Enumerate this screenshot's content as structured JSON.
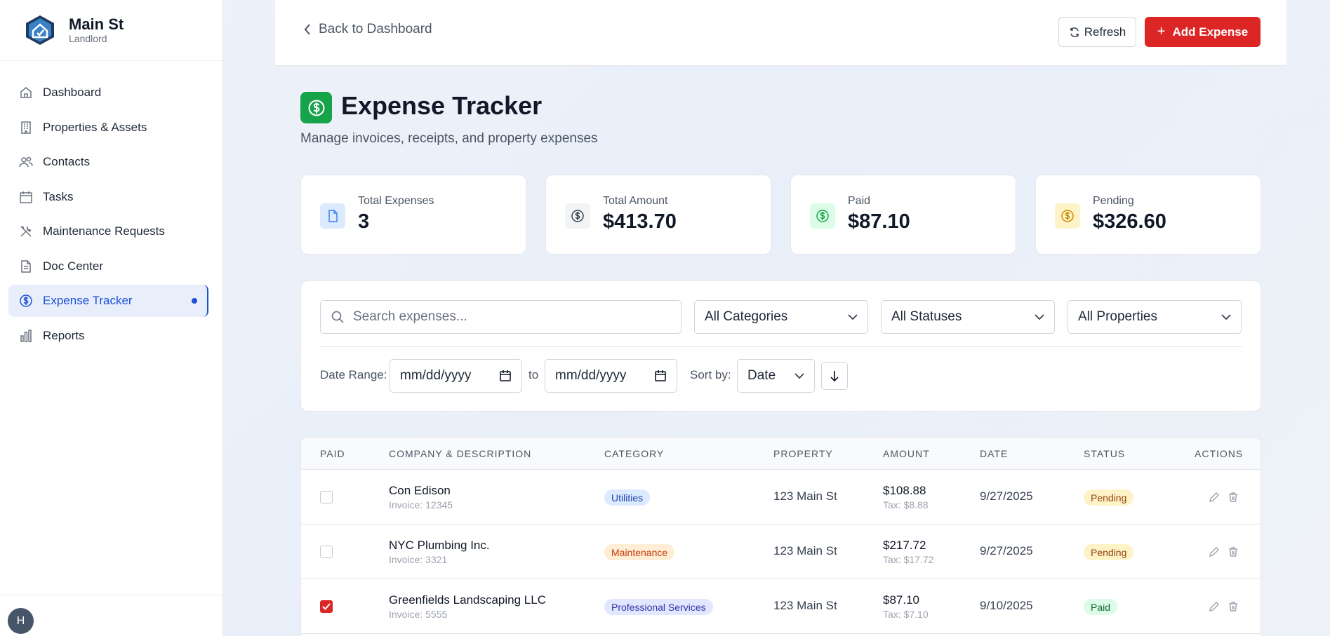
{
  "sidebar": {
    "brand_name": "Main St",
    "brand_role": "Landlord",
    "items": [
      {
        "label": "Dashboard",
        "icon": "home-icon"
      },
      {
        "label": "Properties & Assets",
        "icon": "building-icon"
      },
      {
        "label": "Contacts",
        "icon": "users-icon"
      },
      {
        "label": "Tasks",
        "icon": "calendar-icon"
      },
      {
        "label": "Maintenance Requests",
        "icon": "tools-icon"
      },
      {
        "label": "Doc Center",
        "icon": "document-icon"
      },
      {
        "label": "Expense Tracker",
        "icon": "dollar-circle-icon",
        "active": true
      },
      {
        "label": "Reports",
        "icon": "bar-chart-icon"
      }
    ],
    "avatar_initial": "H"
  },
  "topbar": {
    "back_label": "Back to Dashboard",
    "refresh_label": "Refresh",
    "add_label": "Add Expense"
  },
  "header": {
    "title": "Expense Tracker",
    "subtitle": "Manage invoices, receipts, and property expenses"
  },
  "stats": [
    {
      "label": "Total Expenses",
      "value": "3",
      "icon": "file-icon",
      "color": "#3b82f6"
    },
    {
      "label": "Total Amount",
      "value": "$413.70",
      "icon": "dollar-circle-icon",
      "color": "#374151"
    },
    {
      "label": "Paid",
      "value": "$87.10",
      "icon": "dollar-circle-icon",
      "color": "#16a34a"
    },
    {
      "label": "Pending",
      "value": "$326.60",
      "icon": "dollar-circle-icon",
      "color": "#ca8a04"
    }
  ],
  "filters": {
    "search_placeholder": "Search expenses...",
    "category": "All Categories",
    "status": "All Statuses",
    "property": "All Properties",
    "date_range_label": "Date Range:",
    "date_from": "mm/dd/yyyy",
    "to_label": "to",
    "date_to": "mm/dd/yyyy",
    "sort_label": "Sort by:",
    "sort_value": "Date"
  },
  "table": {
    "headers": [
      "PAID",
      "COMPANY & DESCRIPTION",
      "CATEGORY",
      "PROPERTY",
      "AMOUNT",
      "DATE",
      "STATUS",
      "ACTIONS"
    ],
    "rows": [
      {
        "paid": false,
        "company": "Con Edison",
        "invoice": "Invoice: 12345",
        "category": "Utilities",
        "property": "123 Main St",
        "amount": "$108.88",
        "tax": "Tax: $8.88",
        "date": "9/27/2025",
        "status": "Pending"
      },
      {
        "paid": false,
        "company": "NYC Plumbing Inc.",
        "invoice": "Invoice: 3321",
        "category": "Maintenance",
        "property": "123 Main St",
        "amount": "$217.72",
        "tax": "Tax: $17.72",
        "date": "9/27/2025",
        "status": "Pending"
      },
      {
        "paid": true,
        "company": "Greenfields Landscaping LLC",
        "invoice": "Invoice: 5555",
        "category": "Professional Services",
        "property": "123 Main St",
        "amount": "$87.10",
        "tax": "Tax: $7.10",
        "date": "9/10/2025",
        "status": "Paid"
      }
    ]
  },
  "colors": {
    "accent": "#dc2626",
    "active_nav": "#1d4ed8",
    "utilities_badge": "#dbeafe",
    "maintenance_badge": "#ffedd5",
    "services_badge": "#e0e7ff",
    "pending_badge": "#fef3c7",
    "paid_badge": "#dcfce7"
  }
}
